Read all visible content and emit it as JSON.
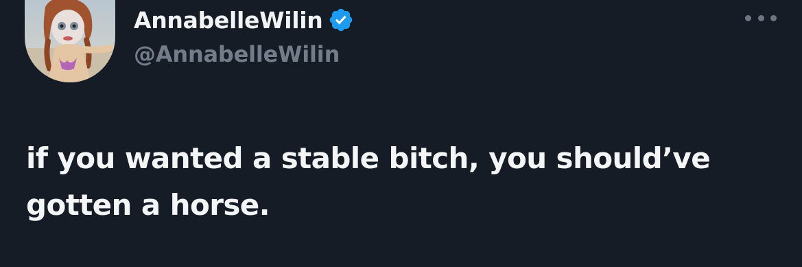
{
  "author": {
    "display_name": "AnnabelleWilin",
    "handle": "@AnnabelleWilin",
    "verified": true
  },
  "tweet": {
    "text": "if you wanted a stable bitch, you should’ve gotten a horse."
  },
  "icons": {
    "verified": "verified-badge-icon",
    "more": "more-options-icon",
    "avatar": "avatar-image"
  },
  "colors": {
    "background": "#161c26",
    "text_primary": "#f4f5f6",
    "text_secondary": "#727d89",
    "verified_blue": "#1d9bf0"
  }
}
